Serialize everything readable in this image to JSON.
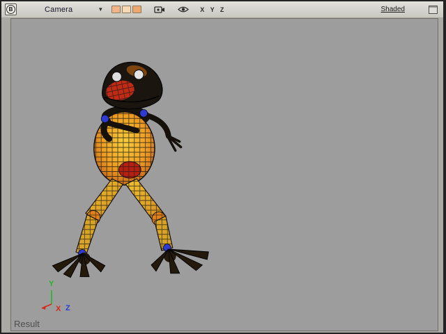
{
  "toolbar": {
    "b_button_label": "B",
    "camera_label": "Camera",
    "dropdown_glyph": "▼",
    "xyz_label": "X Y Z",
    "shaded_label": "Shaded",
    "swatch_colors": [
      "#f2b488",
      "#f8d9b6",
      "#eda76e"
    ],
    "icons": [
      "render-camera-icon",
      "visibility-eye-icon"
    ]
  },
  "viewport": {
    "result_label": "Result",
    "model_name": "frog-character-shaded-wireframe",
    "axis_labels": {
      "x": "X",
      "y": "Y",
      "z": "Z"
    },
    "axis_colors": {
      "x": "#d42a1a",
      "y": "#27b427",
      "z": "#2a3cdc"
    }
  },
  "colors": {
    "toolbar_bg": "#d5d4cd",
    "viewport_bg": "#9d9d9d",
    "frog_belly_inner": "#f6cf3e",
    "frog_belly_outer": "#b5541a",
    "frog_face_red": "#bf2b15",
    "frog_accent_blue": "#2f3bd0",
    "wireframe": "#141414"
  }
}
